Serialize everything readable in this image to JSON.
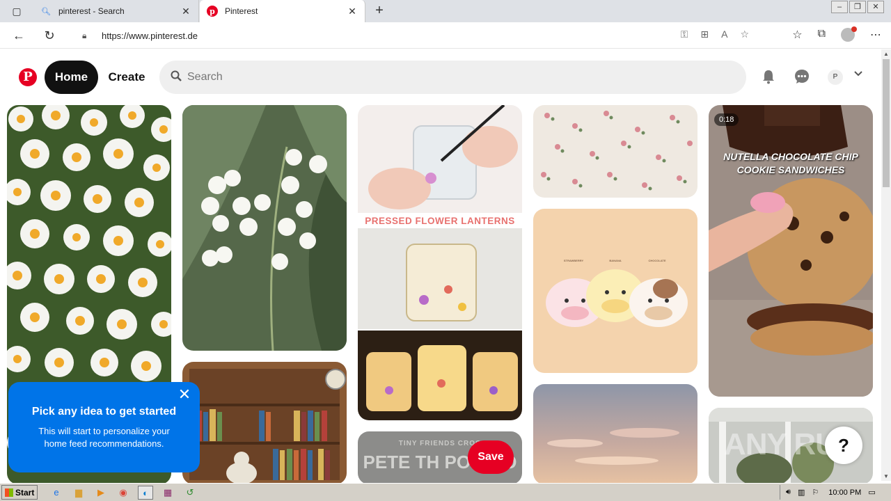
{
  "browser": {
    "tabs": [
      {
        "title": "pinterest - Search",
        "icon": "search-icon"
      },
      {
        "title": "Pinterest",
        "icon": "pinterest-icon"
      }
    ],
    "url": "https://www.pinterest.de"
  },
  "header": {
    "home_label": "Home",
    "create_label": "Create",
    "search_placeholder": "Search",
    "avatar_initial": "P"
  },
  "pins": {
    "lanterns_title": "PRESSED FLOWER LANTERNS",
    "nutella_title": "NUTELLA CHOCOLATE CHIP COOKIE SANDWICHES",
    "video_duration": "0:18",
    "tiny_friends_subtitle": "TINY FRIENDS CROC",
    "tiny_friends_title": "PETE TH POTATO",
    "cow_labels": [
      "STRAWBERRY",
      "BANANA",
      "CHOCOLATE"
    ]
  },
  "save_label": "Save",
  "onboarding": {
    "title": "Pick any idea to get started",
    "body": "This will start to personalize your home feed recommendations."
  },
  "help_label": "?",
  "watermark": "ANY RUN",
  "taskbar": {
    "start_label": "Start",
    "time": "10:00 PM"
  }
}
